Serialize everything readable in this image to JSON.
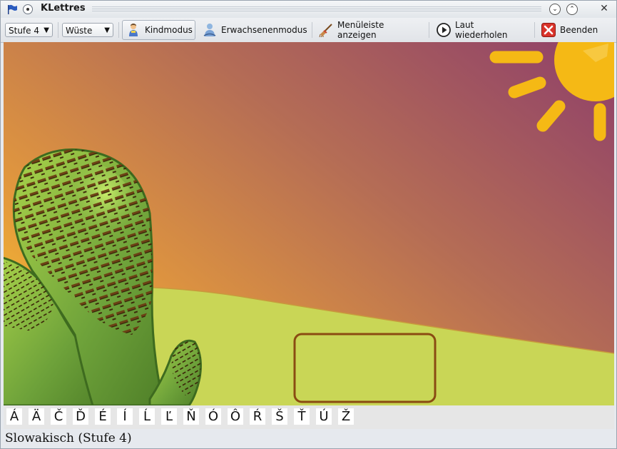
{
  "app": {
    "title": "KLettres"
  },
  "titlebar": {
    "minimize_symbol": "⌄",
    "maximize_symbol": "⌃",
    "close_symbol": "✕"
  },
  "toolbar": {
    "level_select": "Stufe 4",
    "theme_select": "Wüste",
    "kid_mode": "Kindmodus",
    "adult_mode": "Erwachsenenmodus",
    "show_menubar": "Menüleiste anzeigen",
    "repeat_sound": "Laut wiederholen",
    "quit": "Beenden"
  },
  "letters": [
    "Á",
    "Ä",
    "Č",
    "Ď",
    "É",
    "Í",
    "Ĺ",
    "Ľ",
    "Ň",
    "Ó",
    "Ô",
    "Ŕ",
    "Š",
    "Ť",
    "Ú",
    "Ž"
  ],
  "status": {
    "text": "Slowakisch (Stufe 4)"
  },
  "colors": {
    "sky_top": "#8e3f6a",
    "sky_bottom": "#e8a83a",
    "sand": "#c9d656",
    "cactus": "#6ea23a",
    "sun": "#f5b915",
    "input_border": "#8a4b12"
  },
  "icons": {
    "kid_mode": "kid-icon",
    "adult_mode": "adult-icon",
    "show_menubar": "broom-icon",
    "repeat_sound": "play-icon",
    "quit": "quit-icon"
  }
}
